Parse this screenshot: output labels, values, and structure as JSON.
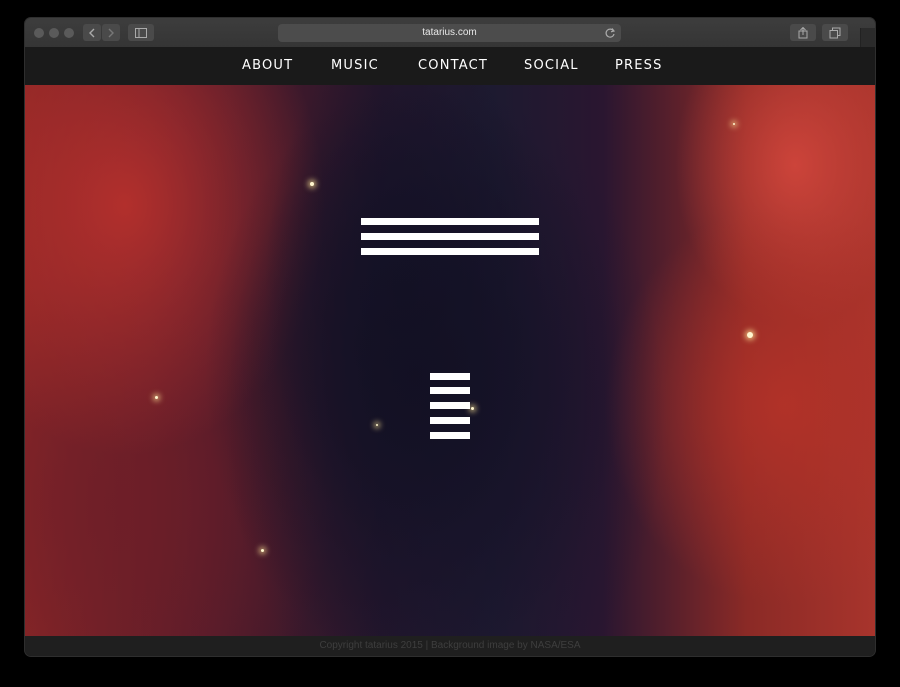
{
  "browser": {
    "url": "tatarius.com",
    "icons": [
      "back-arrow-icon",
      "forward-arrow-icon",
      "sidebar-icon",
      "reload-icon",
      "share-icon",
      "tabs-icon"
    ]
  },
  "nav": {
    "items": [
      {
        "label": "ABOUT"
      },
      {
        "label": "MUSIC"
      },
      {
        "label": "CONTACT"
      },
      {
        "label": "SOCIAL"
      },
      {
        "label": "PRESS"
      }
    ]
  },
  "hero": {
    "logo_icon": "three-bar-logo-icon",
    "menu_icon": "five-bar-menu-icon",
    "bar_color": "#ffffff"
  },
  "footer": {
    "text": "Copyright tatarius 2015 | Background image by NASA/ESA"
  }
}
